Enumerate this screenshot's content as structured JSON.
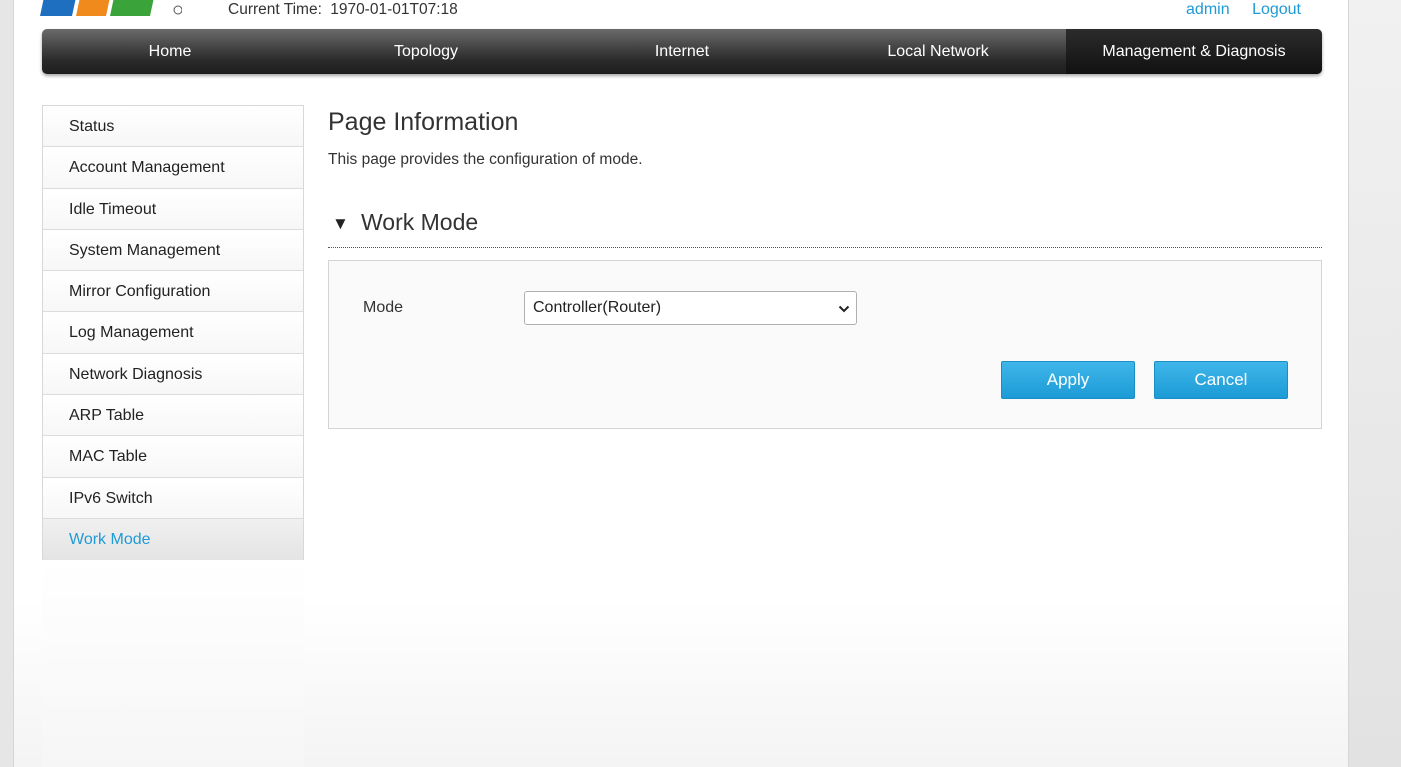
{
  "header": {
    "current_time_label": "Current Time:",
    "current_time_value": "1970-01-01T07:18",
    "user": "admin",
    "logout": "Logout"
  },
  "nav": {
    "items": [
      "Home",
      "Topology",
      "Internet",
      "Local Network",
      "Management & Diagnosis"
    ],
    "active": "Management & Diagnosis"
  },
  "sidebar": {
    "items": [
      "Status",
      "Account Management",
      "Idle Timeout",
      "System Management",
      "Mirror Configuration",
      "Log Management",
      "Network Diagnosis",
      "ARP Table",
      "MAC Table",
      "IPv6 Switch",
      "Work Mode"
    ],
    "active": "Work Mode"
  },
  "main": {
    "title": "Page Information",
    "description": "This page provides the configuration of mode.",
    "section_arrow": "▼",
    "section_title": "Work Mode",
    "mode_label": "Mode",
    "mode_value": "Controller(Router)",
    "apply_label": "Apply",
    "cancel_label": "Cancel"
  },
  "colors": {
    "accent": "#1f9ad6",
    "button": "#29a7e1",
    "nav_bg": "#2a2a2a"
  }
}
